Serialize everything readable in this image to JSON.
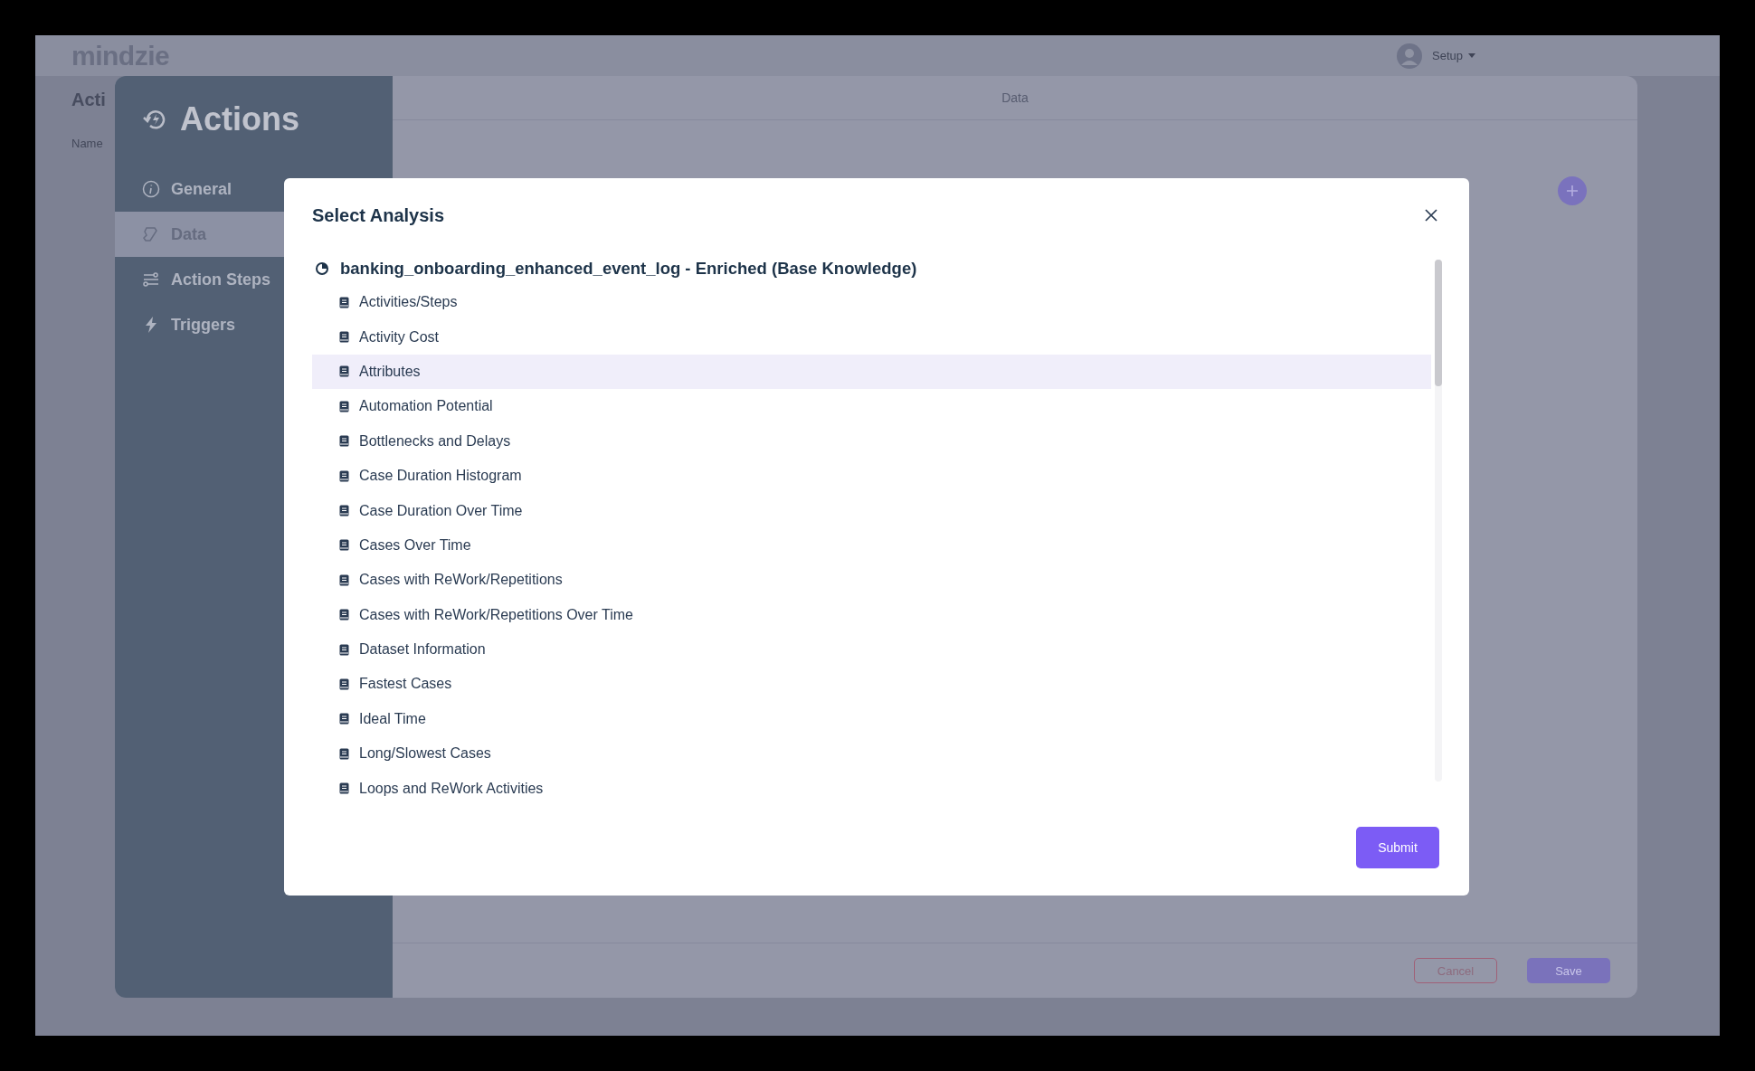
{
  "app": {
    "logo": "mindzie",
    "user_menu": "Setup",
    "page_title": "Acti",
    "field_label": "Name"
  },
  "actions_panel": {
    "title": "Actions",
    "header": "Data",
    "nav": [
      {
        "label": "General",
        "kind": "info",
        "selected": false
      },
      {
        "label": "Data",
        "kind": "data",
        "selected": true
      },
      {
        "label": "Action Steps",
        "kind": "steps",
        "selected": false
      },
      {
        "label": "Triggers",
        "kind": "trigger",
        "selected": false
      }
    ],
    "buttons": [
      {
        "label": "Cancel",
        "kind": "secondary"
      },
      {
        "label": "Save",
        "kind": "primary"
      }
    ]
  },
  "modal": {
    "title": "Select Analysis",
    "submit": "Submit",
    "tree": {
      "label": "banking_onboarding_enhanced_event_log - Enriched (Base Knowledge)",
      "children": [
        {
          "label": "Activities/Steps",
          "selected": false
        },
        {
          "label": "Activity Cost",
          "selected": false
        },
        {
          "label": "Attributes",
          "selected": true
        },
        {
          "label": "Automation Potential",
          "selected": false
        },
        {
          "label": "Bottlenecks and Delays",
          "selected": false
        },
        {
          "label": "Case Duration Histogram",
          "selected": false
        },
        {
          "label": "Case Duration Over Time",
          "selected": false
        },
        {
          "label": "Cases Over Time",
          "selected": false
        },
        {
          "label": "Cases with ReWork/Repetitions",
          "selected": false
        },
        {
          "label": "Cases with ReWork/Repetitions Over Time",
          "selected": false
        },
        {
          "label": "Dataset Information",
          "selected": false
        },
        {
          "label": "Fastest Cases",
          "selected": false
        },
        {
          "label": "Ideal Time",
          "selected": false
        },
        {
          "label": "Long/Slowest Cases",
          "selected": false
        },
        {
          "label": "Loops and ReWork Activities",
          "selected": false
        }
      ]
    }
  }
}
